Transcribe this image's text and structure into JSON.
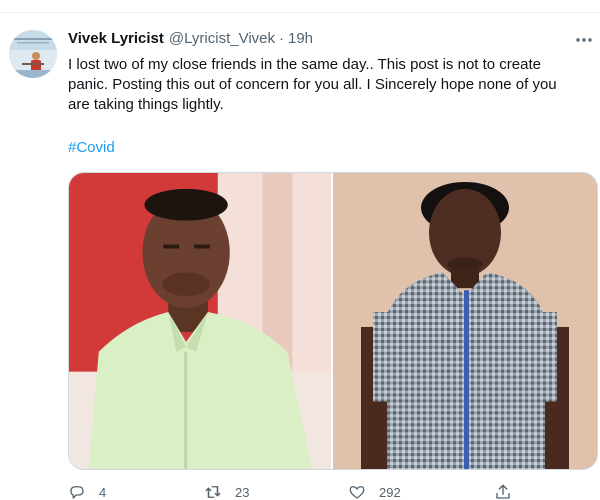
{
  "tweet": {
    "author_name": "Vivek Lyricist",
    "author_handle": "@Lyricist_Vivek",
    "separator": "·",
    "timestamp": "19h",
    "text_lines": [
      "I lost two of my close friends in the same day.. This post is not to create",
      "panic. Posting this out of concern for you all. I Sincerely hope none of you",
      "are taking things lightly."
    ],
    "hashtag": "#Covid",
    "media": [
      {
        "icon": "photo-man-light-green-shirt"
      },
      {
        "icon": "photo-man-checked-shirt"
      }
    ]
  },
  "actions": {
    "reply_count": "4",
    "retweet_count": "23",
    "like_count": "292"
  },
  "colors": {
    "text": "#0f1419",
    "secondary": "#536471",
    "link": "#1d9bf0",
    "border": "#cfd9de"
  }
}
